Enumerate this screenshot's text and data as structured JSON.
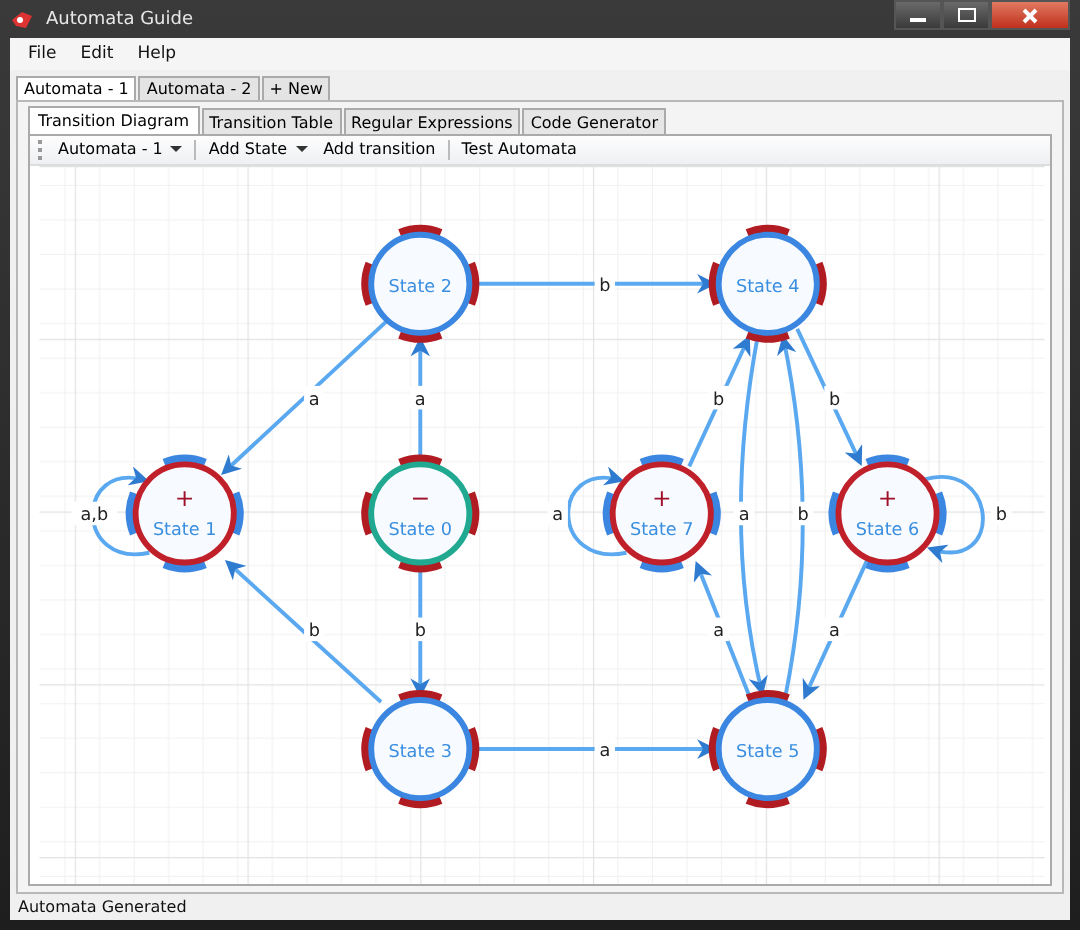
{
  "window": {
    "title": "Automata Guide"
  },
  "menu": [
    "File",
    "Edit",
    "Help"
  ],
  "document_tabs": [
    {
      "label": "Automata - 1",
      "selected": true
    },
    {
      "label": "Automata - 2",
      "selected": false
    },
    {
      "label": "+ New",
      "selected": false
    }
  ],
  "view_tabs": [
    {
      "label": "Transition Diagram",
      "selected": true
    },
    {
      "label": "Transition Table",
      "selected": false
    },
    {
      "label": "Regular Expressions",
      "selected": false
    },
    {
      "label": "Code Generator",
      "selected": false
    }
  ],
  "toolbar": [
    {
      "label": "Automata - 1",
      "kind": "dropdown"
    },
    {
      "label": "Add State",
      "kind": "dropdown"
    },
    {
      "label": "Add transition",
      "kind": "button"
    },
    {
      "label": "Test Automata",
      "kind": "button"
    }
  ],
  "states": [
    {
      "label": "State 2",
      "kind": "normal"
    },
    {
      "label": "State 4",
      "kind": "normal"
    },
    {
      "label": "State 1",
      "kind": "final",
      "sign": "+"
    },
    {
      "label": "State 0",
      "kind": "start",
      "sign": "−"
    },
    {
      "label": "State 7",
      "kind": "final",
      "sign": "+"
    },
    {
      "label": "State 6",
      "kind": "final",
      "sign": "+"
    },
    {
      "label": "State 3",
      "kind": "normal"
    },
    {
      "label": "State 5",
      "kind": "normal"
    }
  ],
  "transitions": [
    {
      "label": "b"
    },
    {
      "label": "a"
    },
    {
      "label": "a"
    },
    {
      "label": "a,b"
    },
    {
      "label": "b"
    },
    {
      "label": "b"
    },
    {
      "label": "a"
    },
    {
      "label": "b"
    },
    {
      "label": "b"
    },
    {
      "label": "a"
    },
    {
      "label": "a"
    },
    {
      "label": "b"
    },
    {
      "label": "b"
    },
    {
      "label": "a"
    },
    {
      "label": "a"
    }
  ],
  "status_bar": "Automata Generated"
}
